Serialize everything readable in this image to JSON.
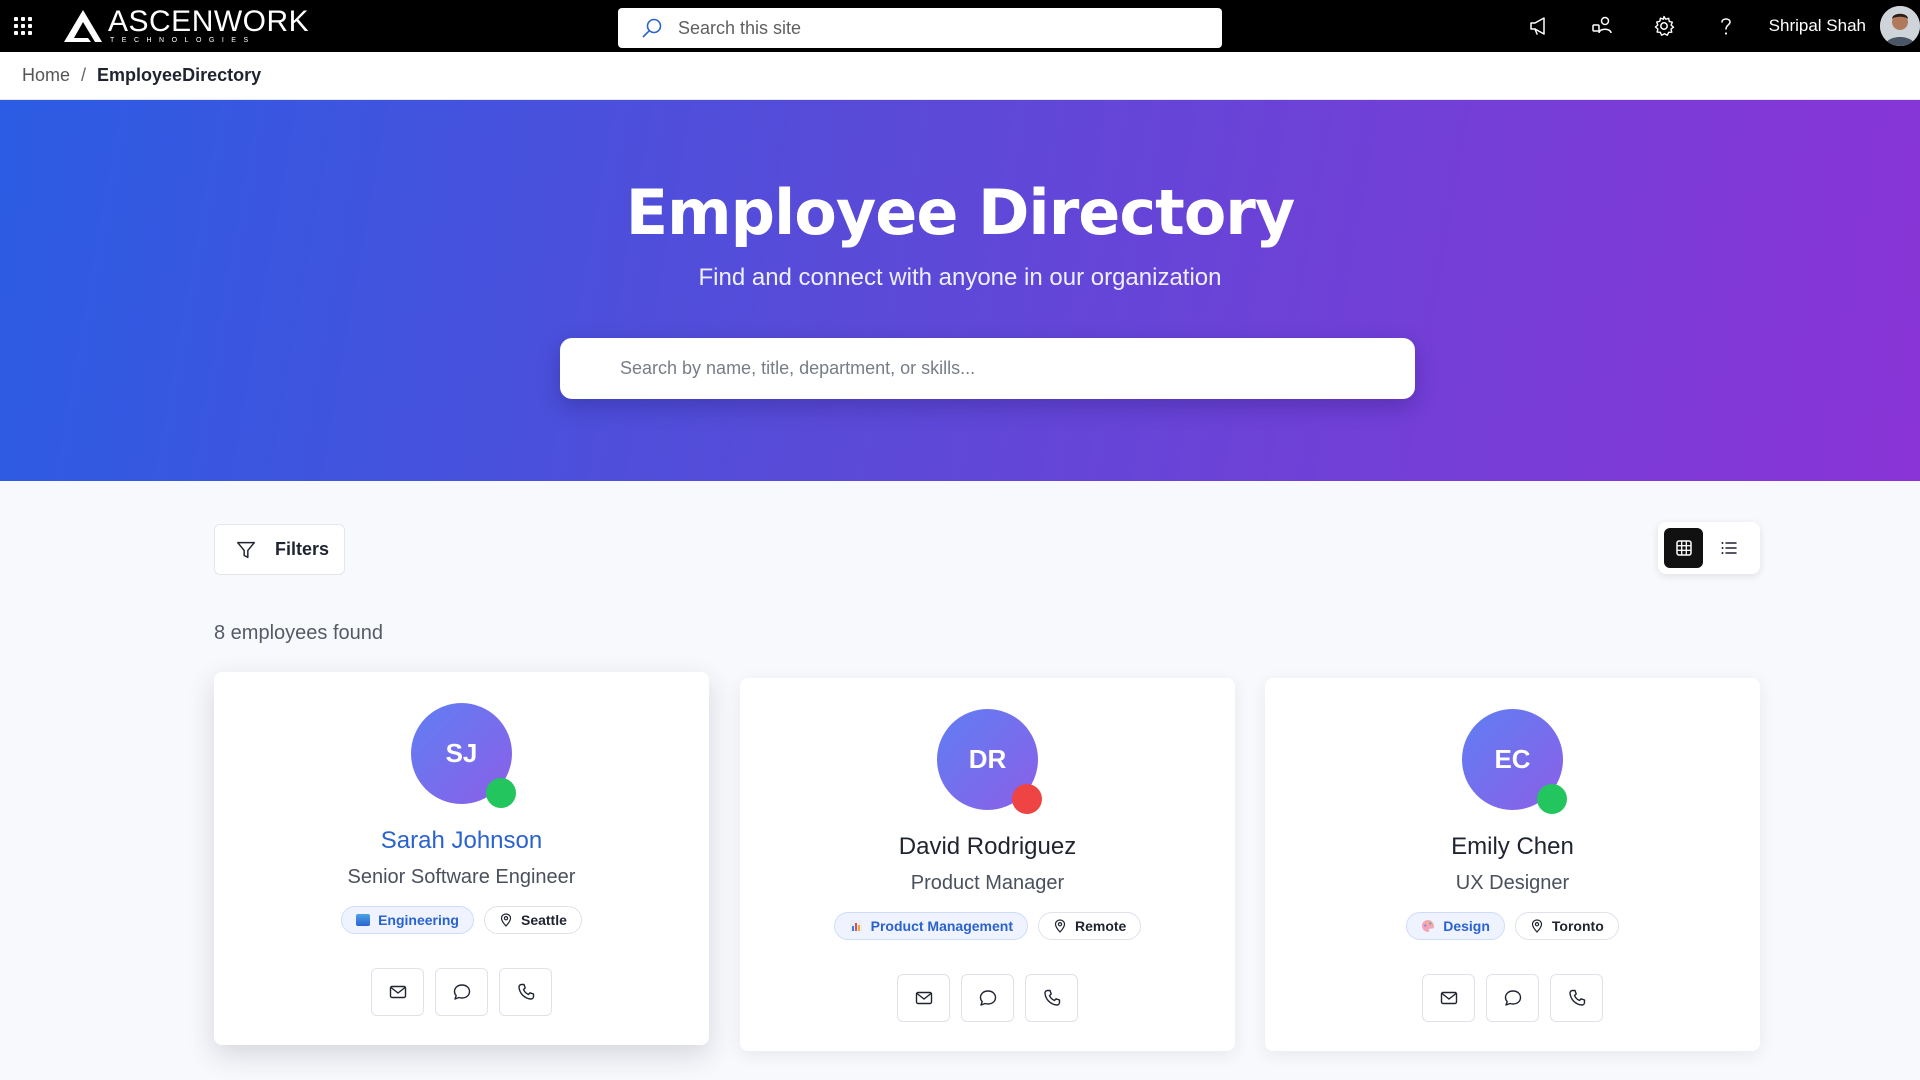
{
  "suite": {
    "brand_name": "ASCENWORK",
    "brand_sub": "TECHNOLOGIES",
    "search_placeholder": "Search this site",
    "user_name": "Shripal Shah",
    "icons": [
      "megaphone-icon",
      "people-icon",
      "gear-icon",
      "help-icon"
    ]
  },
  "breadcrumb": {
    "home": "Home",
    "separator": "/",
    "current": "EmployeeDirectory"
  },
  "hero": {
    "title": "Employee Directory",
    "subtitle": "Find and connect with anyone in our organization",
    "search_placeholder": "Search by name, title, department, or skills..."
  },
  "toolbar": {
    "filters_label": "Filters",
    "view_mode": "grid",
    "result_count": "8 employees found"
  },
  "employees": [
    {
      "initials": "SJ",
      "name": "Sarah Johnson",
      "title": "Senior Software Engineer",
      "department": "Engineering",
      "department_icon": "laptop-icon",
      "location": "Seattle",
      "status": "online",
      "hovered": true
    },
    {
      "initials": "DR",
      "name": "David Rodriguez",
      "title": "Product Manager",
      "department": "Product Management",
      "department_icon": "chart-icon",
      "location": "Remote",
      "status": "busy",
      "hovered": false
    },
    {
      "initials": "EC",
      "name": "Emily Chen",
      "title": "UX Designer",
      "department": "Design",
      "department_icon": "palette-icon",
      "location": "Toronto",
      "status": "online",
      "hovered": false
    }
  ],
  "colors": {
    "hero_start": "#2b5ce3",
    "hero_end": "#8a34d6",
    "link": "#2a62cf",
    "online": "#22c55e",
    "busy": "#ef4444"
  }
}
